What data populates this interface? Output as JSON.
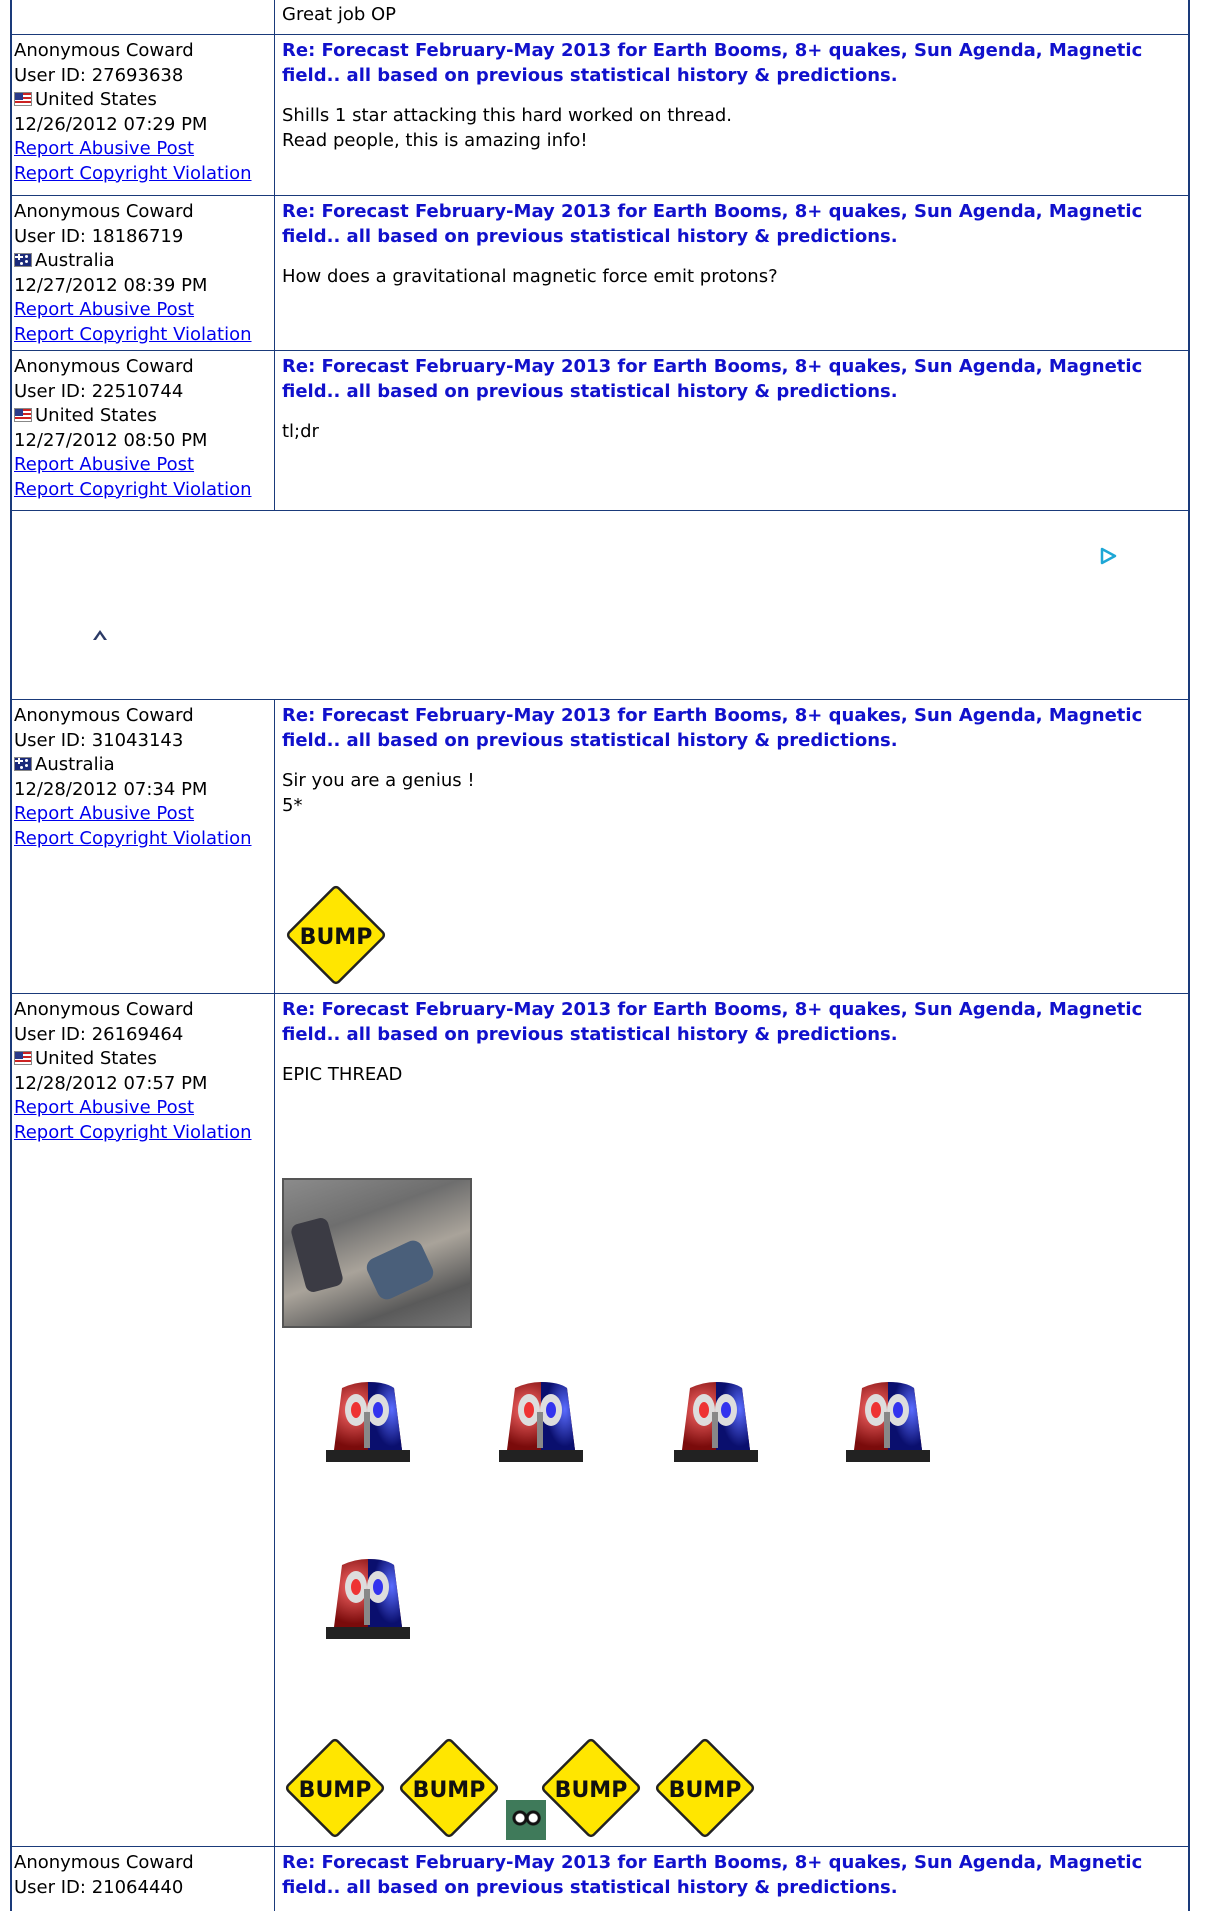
{
  "thread": {
    "top_partial_post": {
      "body": [
        "Great job OP"
      ]
    },
    "posts": [
      {
        "author": "Anonymous Coward",
        "user_id": "User ID: 27693638",
        "country": "United States",
        "flag": "us-flag-icon",
        "datetime": "12/26/2012 07:29 PM",
        "report_abuse": "Report Abusive Post",
        "report_copyright": "Report Copyright Violation",
        "title": "Re: Forecast February-May 2013 for Earth Booms, 8+ quakes, Sun Agenda, Magnetic field.. all based on previous statistical history & predictions.",
        "body": [
          "Shills 1 star attacking this hard worked on thread.",
          "Read people, this is amazing info!"
        ]
      },
      {
        "author": "Anonymous Coward",
        "user_id": "User ID: 18186719",
        "country": "Australia",
        "flag": "au-flag-icon",
        "datetime": "12/27/2012 08:39 PM",
        "report_abuse": "Report Abusive Post",
        "report_copyright": "Report Copyright Violation",
        "title": "Re: Forecast February-May 2013 for Earth Booms, 8+ quakes, Sun Agenda, Magnetic field.. all based on previous statistical history & predictions.",
        "body": [
          "How does a gravitational magnetic force emit protons?"
        ]
      },
      {
        "author": "Anonymous Coward",
        "user_id": "User ID: 22510744",
        "country": "United States",
        "flag": "us-flag-icon",
        "datetime": "12/27/2012 08:50 PM",
        "report_abuse": "Report Abusive Post",
        "report_copyright": "Report Copyright Violation",
        "title": "Re: Forecast February-May 2013 for Earth Booms, 8+ quakes, Sun Agenda, Magnetic field.. all based on previous statistical history & predictions.",
        "body": [
          "tl;dr"
        ]
      },
      {
        "author": "Anonymous Coward",
        "user_id": "User ID: 31043143",
        "country": "Australia",
        "flag": "au-flag-icon",
        "datetime": "12/28/2012 07:34 PM",
        "report_abuse": "Report Abusive Post",
        "report_copyright": "Report Copyright Violation",
        "title": "Re: Forecast February-May 2013 for Earth Booms, 8+ quakes, Sun Agenda, Magnetic field.. all based on previous statistical history & predictions.",
        "body": [
          "Sir you are a genius !",
          "5*"
        ],
        "images": [
          "bump-sign"
        ]
      },
      {
        "author": "Anonymous Coward",
        "user_id": "User ID: 26169464",
        "country": "United States",
        "flag": "us-flag-icon",
        "datetime": "12/28/2012 07:57 PM",
        "report_abuse": "Report Abusive Post",
        "report_copyright": "Report Copyright Violation",
        "title": "Re: Forecast February-May 2013 for Earth Booms, 8+ quakes, Sun Agenda, Magnetic field.. all based on previous statistical history & predictions.",
        "body": [
          "EPIC THREAD"
        ],
        "images": [
          "zombie-photo",
          "siren",
          "siren",
          "siren",
          "siren",
          "siren",
          "bump-sign",
          "bump-sign",
          "ghoul-face",
          "bump-sign",
          "bump-sign"
        ]
      },
      {
        "author": "Anonymous Coward",
        "user_id": "User ID: 21064440",
        "title": "Re: Forecast February-May 2013 for Earth Booms, 8+ quakes, Sun Agenda, Magnetic field.. all based on previous statistical history & predictions."
      }
    ],
    "bump_text": "BUMP",
    "ad_icons": [
      "ad-play-icon",
      "ad-choices-icon"
    ],
    "colors": {
      "border": "#1a3a7a",
      "title": "#1111cc",
      "link": "#0000ee",
      "bump_fill": "#ffe600"
    }
  }
}
